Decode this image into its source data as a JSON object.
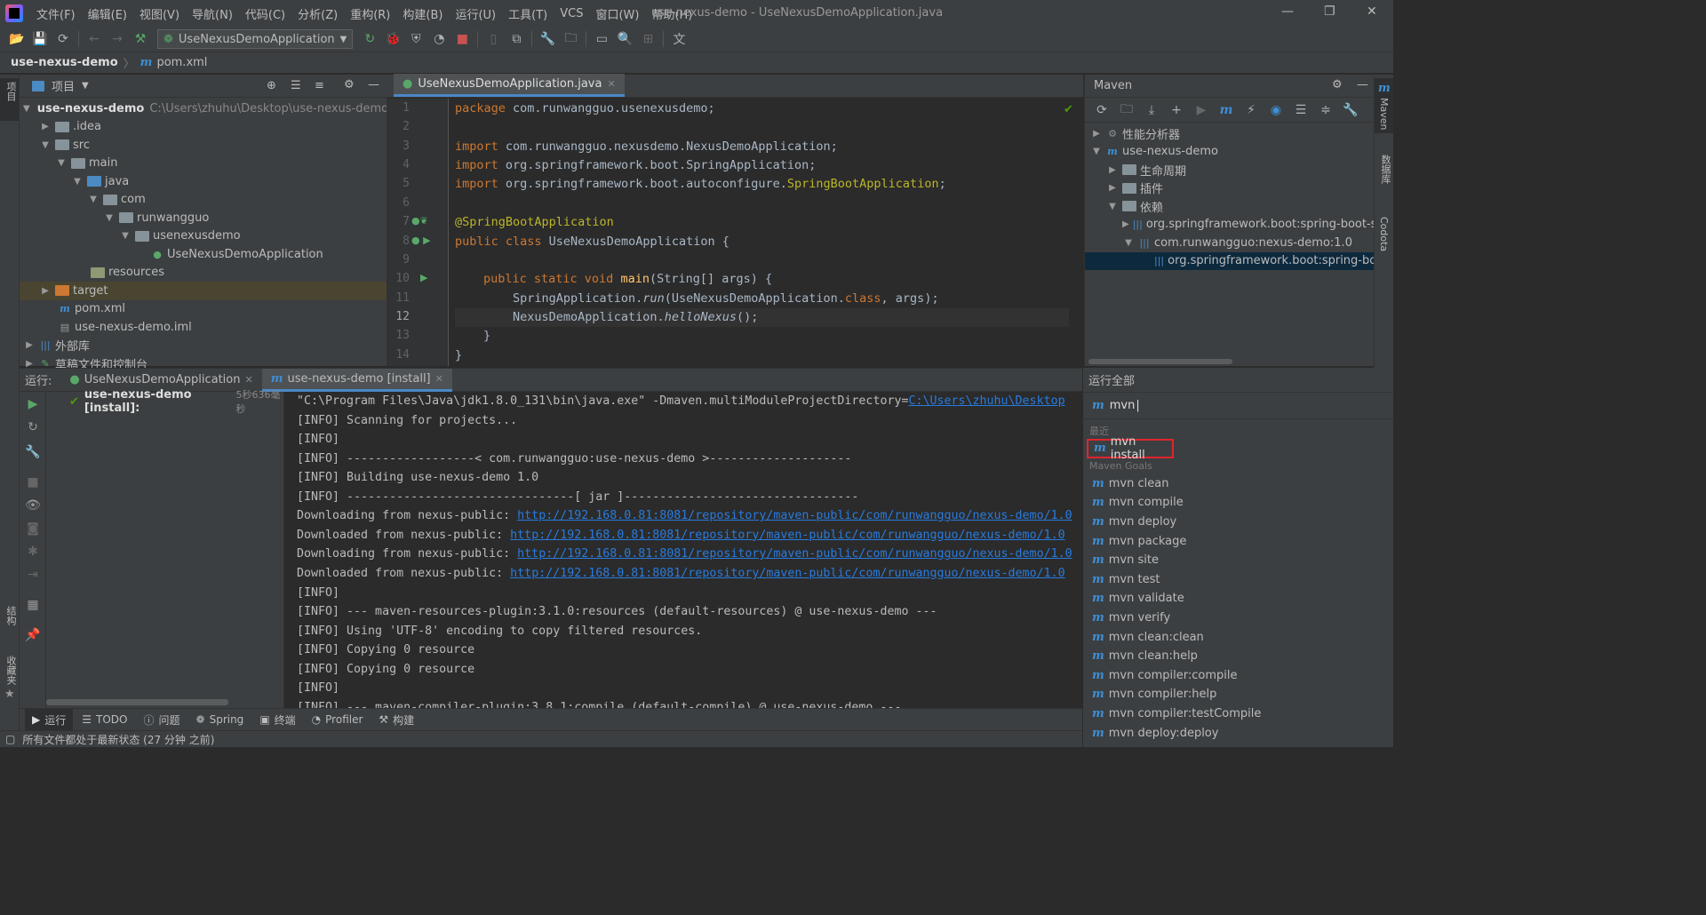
{
  "app": {
    "window_title": "use-nexus-demo - UseNexusDemoApplication.java",
    "menu": [
      "文件(F)",
      "编辑(E)",
      "视图(V)",
      "导航(N)",
      "代码(C)",
      "分析(Z)",
      "重构(R)",
      "构建(B)",
      "运行(U)",
      "工具(T)",
      "VCS",
      "窗口(W)",
      "帮助(H)"
    ]
  },
  "toolbar": {
    "run_config": "UseNexusDemoApplication"
  },
  "breadcrumb": {
    "project": "use-nexus-demo",
    "file": "pom.xml"
  },
  "left_stripe": {
    "project_label": "项目",
    "structure_label": "结构",
    "favorites_label": "收藏夹"
  },
  "right_stripe": {
    "maven_label": "Maven",
    "database_label": "数据库",
    "codota_label": "Codota"
  },
  "project_panel": {
    "title": "项目",
    "tree": [
      {
        "label": "use-nexus-demo",
        "path": "C:\\Users\\zhuhu\\Desktop\\use-nexus-demo"
      },
      {
        "label": ".idea"
      },
      {
        "label": "src"
      },
      {
        "label": "main"
      },
      {
        "label": "java"
      },
      {
        "label": "com"
      },
      {
        "label": "runwangguo"
      },
      {
        "label": "usenexusdemo"
      },
      {
        "label": "UseNexusDemoApplication"
      },
      {
        "label": "resources"
      },
      {
        "label": "target"
      },
      {
        "label": "pom.xml"
      },
      {
        "label": "use-nexus-demo.iml"
      },
      {
        "label": "外部库"
      },
      {
        "label": "草稿文件和控制台"
      }
    ]
  },
  "editor": {
    "tab": "UseNexusDemoApplication.java",
    "line_numbers": [
      "1",
      "2",
      "3",
      "4",
      "5",
      "6",
      "7",
      "8",
      "9",
      "10",
      "11",
      "12",
      "13",
      "14"
    ],
    "code": {
      "l1_kw": "package",
      "l1_rest": " com.runwangguo.usenexusdemo;",
      "l3_kw": "import",
      "l3_rest": " com.runwangguo.nexusdemo.NexusDemoApplication;",
      "l4_kw": "import",
      "l4_rest": " org.springframework.boot.SpringApplication;",
      "l5_kw": "import",
      "l5_rest": " org.springframework.boot.autoconfigure.",
      "l5_an": "SpringBootApplication",
      "l5_end": ";",
      "l7_an": "@SpringBootApplication",
      "l8_kw": "public class",
      "l8_rest": " UseNexusDemoApplication {",
      "l10_kw": "public static void",
      "l10_fn": " main",
      "l10_rest": "(String[] args) {",
      "l11_a": "SpringApplication.",
      "l11_it": "run",
      "l11_b": "(UseNexusDemoApplication.",
      "l11_kw": "class",
      "l11_c": ", args);",
      "l12_a": "NexusDemoApplication.",
      "l12_it": "helloNexus",
      "l12_b": "();",
      "l13": "}",
      "l14": "}"
    }
  },
  "maven_panel": {
    "title": "Maven",
    "tree": [
      {
        "label": "性能分析器"
      },
      {
        "label": "use-nexus-demo"
      },
      {
        "label": "生命周期"
      },
      {
        "label": "插件"
      },
      {
        "label": "依赖"
      },
      {
        "label": "org.springframework.boot:spring-boot-s"
      },
      {
        "label": "com.runwangguo:nexus-demo:1.0"
      },
      {
        "label": "org.springframework.boot:spring-boo"
      }
    ]
  },
  "run": {
    "label": "运行:",
    "tabs": [
      "UseNexusDemoApplication",
      "use-nexus-demo [install]"
    ],
    "tree_item": "use-nexus-demo [install]:",
    "tree_time": "5秒636毫秒",
    "console": [
      {
        "text": "\"C:\\Program Files\\Java\\jdk1.8.0_131\\bin\\java.exe\" -Dmaven.multiModuleProjectDirectory=",
        "link": "C:\\Users\\zhuhu\\Desktop"
      },
      {
        "text": "[INFO] Scanning for projects...",
        "link": ""
      },
      {
        "text": "[INFO]",
        "link": ""
      },
      {
        "text": "[INFO] ------------------< com.runwangguo:use-nexus-demo >--------------------",
        "link": ""
      },
      {
        "text": "[INFO] Building use-nexus-demo 1.0",
        "link": ""
      },
      {
        "text": "[INFO] --------------------------------[ jar ]---------------------------------",
        "link": ""
      },
      {
        "text": "Downloading from nexus-public: ",
        "link": "http://192.168.0.81:8081/repository/maven-public/com/runwangguo/nexus-demo/1.0"
      },
      {
        "text": "Downloaded from nexus-public: ",
        "link": "http://192.168.0.81:8081/repository/maven-public/com/runwangguo/nexus-demo/1.0"
      },
      {
        "text": "Downloading from nexus-public: ",
        "link": "http://192.168.0.81:8081/repository/maven-public/com/runwangguo/nexus-demo/1.0"
      },
      {
        "text": "Downloaded from nexus-public: ",
        "link": "http://192.168.0.81:8081/repository/maven-public/com/runwangguo/nexus-demo/1.0"
      },
      {
        "text": "[INFO]",
        "link": ""
      },
      {
        "text": "[INFO] --- maven-resources-plugin:3.1.0:resources (default-resources) @ use-nexus-demo ---",
        "link": ""
      },
      {
        "text": "[INFO] Using 'UTF-8' encoding to copy filtered resources.",
        "link": ""
      },
      {
        "text": "[INFO] Copying 0 resource",
        "link": ""
      },
      {
        "text": "[INFO] Copying 0 resource",
        "link": ""
      },
      {
        "text": "[INFO]",
        "link": ""
      },
      {
        "text": "[INFO] --- maven-compiler-plugin:3.8.1:compile (default-compile) @ use-nexus-demo ---",
        "link": ""
      }
    ]
  },
  "run_anything": {
    "title": "运行全部",
    "query": "mvn",
    "recent_label": "最近",
    "recent": [
      "mvn install"
    ],
    "goals_label": "Maven Goals",
    "goals": [
      "mvn clean",
      "mvn compile",
      "mvn deploy",
      "mvn package",
      "mvn site",
      "mvn test",
      "mvn validate",
      "mvn verify",
      "mvn clean:clean",
      "mvn clean:help",
      "mvn compiler:compile",
      "mvn compiler:help",
      "mvn compiler:testCompile",
      "mvn deploy:deploy"
    ]
  },
  "bottom_tabs": [
    "运行",
    "TODO",
    "问题",
    "Spring",
    "终端",
    "Profiler",
    "构建"
  ],
  "status": {
    "text": "所有文件都处于最新状态 (27 分钟 之前)"
  },
  "colors": {
    "accent": "#4a88c7",
    "highlight_border": "#e0242e",
    "link": "#287bde",
    "success": "#4e9a06"
  }
}
